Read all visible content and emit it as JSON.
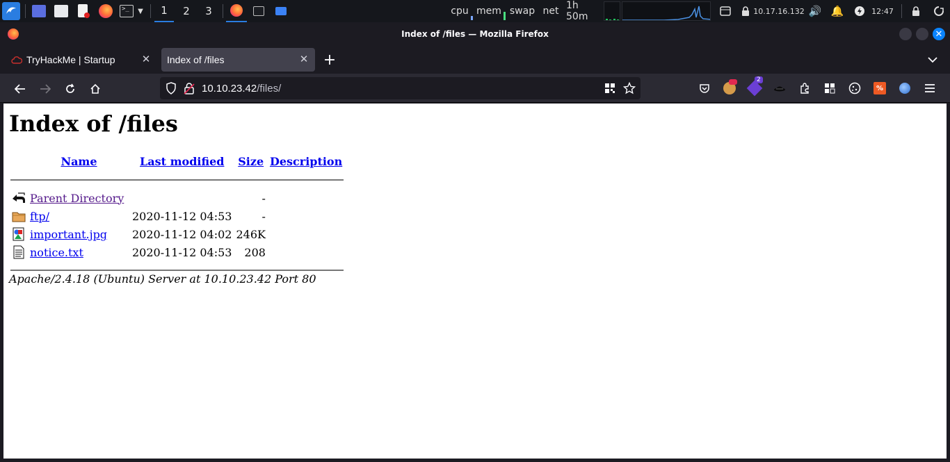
{
  "panel": {
    "workspaces": [
      "1",
      "2",
      "3"
    ],
    "monitors": {
      "cpu": "cpu",
      "mem": "mem",
      "swap": "swap",
      "net": "net"
    },
    "uptime": "1h 50m",
    "ip_address": "10.17.16.132",
    "clock": "12:47"
  },
  "window": {
    "title": "Index of /files — Mozilla Firefox"
  },
  "tabs": [
    {
      "label": "TryHackMe | Startup",
      "selected": false
    },
    {
      "label": "Index of /files",
      "selected": true
    }
  ],
  "urlbar": {
    "host": "10.10.23.42",
    "path": "/files/"
  },
  "extensions": {
    "badge_count": "2"
  },
  "page": {
    "heading": "Index of /files",
    "columns": {
      "name": "Name",
      "modified": "Last modified",
      "size": "Size",
      "description": "Description"
    },
    "rows": [
      {
        "icon": "back-icon",
        "name": "Parent Directory",
        "modified": "",
        "size": "-",
        "description": ""
      },
      {
        "icon": "folder-icon",
        "name": "ftp/",
        "modified": "2020-11-12 04:53",
        "size": "-",
        "description": ""
      },
      {
        "icon": "image-file-icon",
        "name": "important.jpg",
        "modified": "2020-11-12 04:02",
        "size": "246K",
        "description": ""
      },
      {
        "icon": "text-file-icon",
        "name": "notice.txt",
        "modified": "2020-11-12 04:53",
        "size": "208",
        "description": ""
      }
    ],
    "address": "Apache/2.4.18 (Ubuntu) Server at 10.10.23.42 Port 80"
  },
  "colors": {
    "link": "#0000ee",
    "visited_link": "#551a8b",
    "accent": "#0a84ff",
    "panel_accent": "#2a7de1"
  }
}
